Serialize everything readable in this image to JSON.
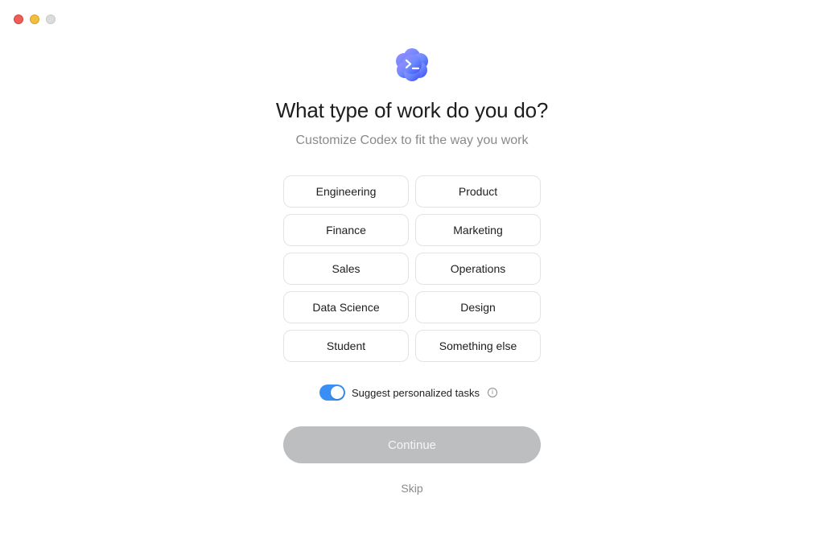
{
  "window": {
    "controls": [
      "close",
      "minimize",
      "zoom"
    ]
  },
  "logo": {
    "icon": "codex-terminal-cloud-icon",
    "colors": [
      "#6b8bff",
      "#3f4bf0",
      "#a58bff"
    ]
  },
  "header": {
    "title": "What type of work do you do?",
    "subtitle": "Customize Codex to fit the way you work"
  },
  "options": [
    {
      "label": "Engineering"
    },
    {
      "label": "Product"
    },
    {
      "label": "Finance"
    },
    {
      "label": "Marketing"
    },
    {
      "label": "Sales"
    },
    {
      "label": "Operations"
    },
    {
      "label": "Data Science"
    },
    {
      "label": "Design"
    },
    {
      "label": "Student"
    },
    {
      "label": "Something else"
    }
  ],
  "toggle": {
    "label": "Suggest personalized tasks",
    "on": true,
    "color": "#3a8ff5",
    "info_icon": "info-icon"
  },
  "actions": {
    "continue_label": "Continue",
    "continue_disabled": true,
    "skip_label": "Skip"
  }
}
